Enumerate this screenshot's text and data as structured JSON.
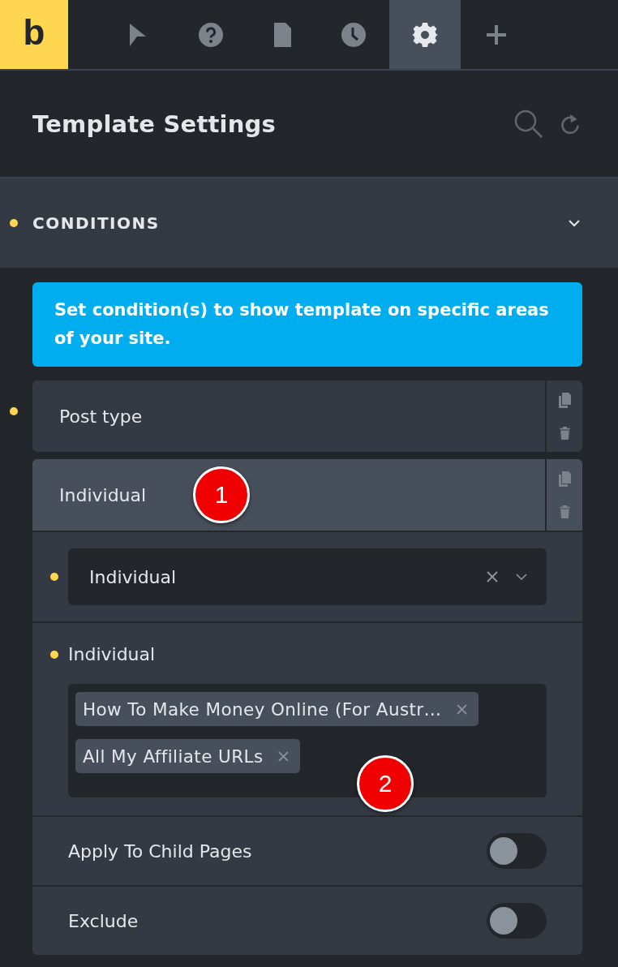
{
  "app_logo": "b",
  "toolbar": {
    "tabs": [
      {
        "kind": "pointer",
        "selected": false
      },
      {
        "kind": "help",
        "selected": false
      },
      {
        "kind": "page",
        "selected": false
      },
      {
        "kind": "history",
        "selected": false
      },
      {
        "kind": "settings",
        "selected": true
      },
      {
        "kind": "add",
        "selected": false
      }
    ]
  },
  "header": {
    "title": "Template Settings"
  },
  "section": {
    "title": "CONDITIONS",
    "changed": true,
    "expanded": true
  },
  "notice": "Set condition(s) to show template on specific areas of your site.",
  "conditions": [
    {
      "label": "Post type",
      "changed": true,
      "expanded": false
    },
    {
      "label": "Individual",
      "changed": false,
      "expanded": true,
      "annotation": "1",
      "fields": [
        {
          "kind": "select",
          "value": "Individual",
          "changed": true
        },
        {
          "kind": "multiselect",
          "label": "Individual",
          "changed": true,
          "annotation": "2",
          "tags": [
            "How To Make Money Online (For Austr…",
            "All My Affiliate URLs"
          ]
        },
        {
          "kind": "toggle",
          "label": "Apply To Child Pages",
          "on": false
        },
        {
          "kind": "toggle",
          "label": "Exclude",
          "on": false
        }
      ]
    }
  ]
}
